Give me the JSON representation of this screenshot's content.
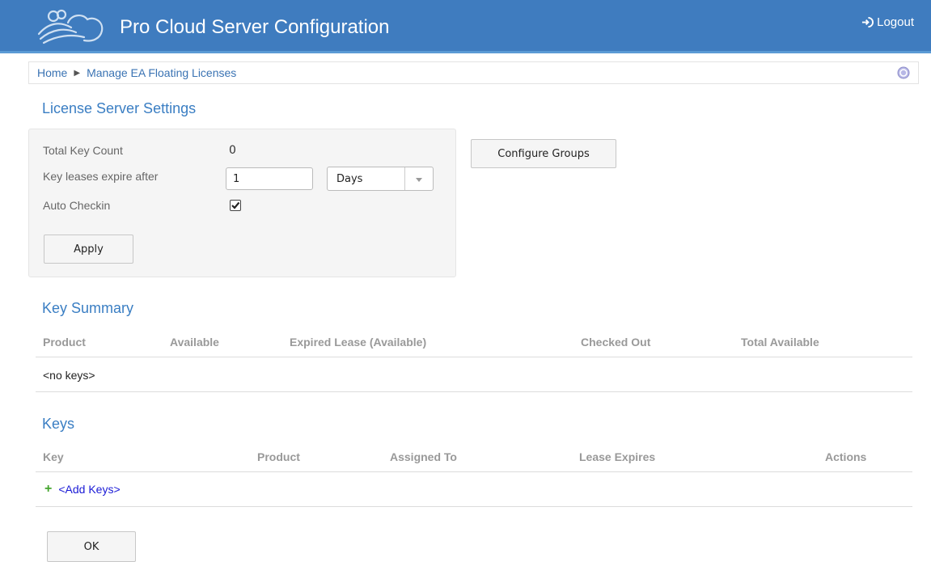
{
  "header": {
    "title": "Pro Cloud Server Configuration",
    "logout_label": "Logout"
  },
  "breadcrumb": {
    "home": "Home",
    "current": "Manage EA Floating Licenses"
  },
  "license_settings": {
    "title": "License Server Settings",
    "total_key_count_label": "Total Key Count",
    "total_key_count_value": "0",
    "lease_label": "Key leases expire after",
    "lease_value": "1",
    "lease_unit": "Days",
    "auto_checkin_label": "Auto Checkin",
    "auto_checkin_checked": true,
    "apply_label": "Apply",
    "configure_groups_label": "Configure Groups"
  },
  "key_summary": {
    "title": "Key Summary",
    "columns": [
      "Product",
      "Available",
      "Expired Lease (Available)",
      "Checked Out",
      "Total Available"
    ],
    "empty_text": "<no keys>"
  },
  "keys": {
    "title": "Keys",
    "columns": [
      "Key",
      "Product",
      "Assigned To",
      "Lease Expires",
      "Actions"
    ],
    "add_keys_label": "<Add Keys>"
  },
  "ok_label": "OK",
  "colors": {
    "header": "#3f7cbf",
    "accent": "#3a7ec3",
    "link": "#1a1ad6",
    "add_icon": "#44a52d"
  }
}
